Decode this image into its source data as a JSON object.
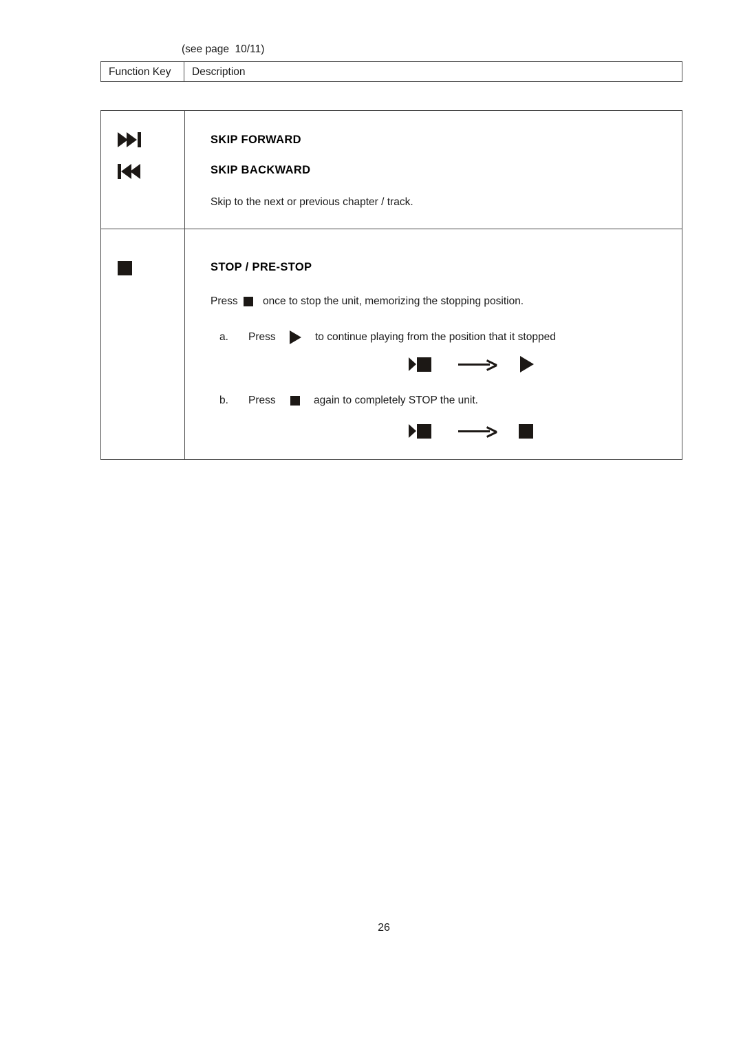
{
  "document": {
    "caption": "(see page  10/11)",
    "page_number": "26",
    "ink_color": "#1c1815",
    "rule_color": "#4a4a4a"
  },
  "header_table": {
    "columns": [
      {
        "label": "Function Key"
      },
      {
        "label": "Description"
      }
    ]
  },
  "rows": [
    {
      "id": "skip",
      "icons": [
        {
          "name": "skip-forward-icon",
          "glyph": "▶▶|"
        },
        {
          "name": "skip-backward-icon",
          "glyph": "|◀◀"
        }
      ],
      "headings": [
        "SKIP FORWARD",
        "SKIP BACKWARD"
      ],
      "description": "Skip to the next or previous chapter / track."
    },
    {
      "id": "stop",
      "icons": [
        {
          "name": "stop-icon",
          "glyph": "■"
        }
      ],
      "headings": [
        "STOP / PRE-STOP"
      ],
      "intro": {
        "before": "Press",
        "icon": "stop-icon",
        "after": "once to stop the unit, memorizing the stopping position."
      },
      "steps": [
        {
          "marker": "a.",
          "before": "Press",
          "icon": "play-icon",
          "after": "to continue playing from the position that it stopped",
          "diagram": {
            "from": "play-stop",
            "arrow": "right-arrow",
            "to": "play"
          }
        },
        {
          "marker": "b.",
          "before": "Press",
          "icon": "stop-icon",
          "after": "again to completely STOP the unit.",
          "diagram": {
            "from": "play-stop",
            "arrow": "right-arrow",
            "to": "stop"
          }
        }
      ]
    }
  ]
}
